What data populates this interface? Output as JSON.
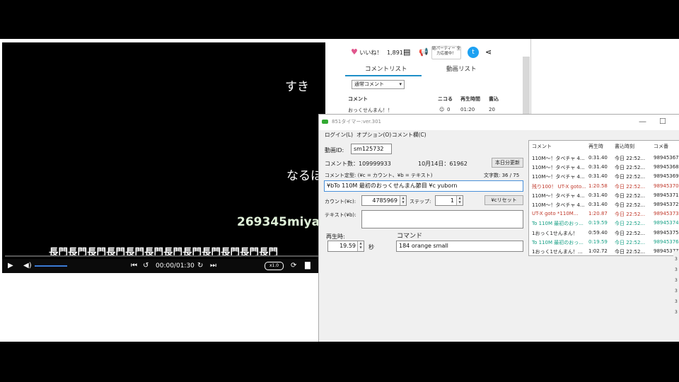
{
  "player": {
    "comments": [
      "すき",
      "な",
      "なるほ",
      "269345miya",
      "長門長門長門長門長門長門長門長門長門長門長門長門"
    ],
    "time": "00:00/01:30",
    "speed": "x1.0"
  },
  "nico": {
    "like_label": "いいね！",
    "like_count": "1,891",
    "party_label": "結パーティー 全力応援中！",
    "tabs": [
      "コメントリスト",
      "動画リスト"
    ],
    "sort_select": "通常コメント",
    "headers": [
      "コメント",
      "ニコる",
      "再生時間",
      "書込"
    ],
    "row": {
      "comment": "おっくせんまん！！",
      "nicoru": "0",
      "time": "01:20",
      "date": "20"
    }
  },
  "timer": {
    "title": "851タイマー:ver.301",
    "menus": [
      "ログイン(L)",
      "オプション(O)",
      "コメント欄(C)"
    ],
    "video_id_label": "動画ID:",
    "video_id": "sm125732",
    "comment_count": "コメント数：109999933",
    "date_info": "10月14日：61962",
    "update_button": "本日分更新",
    "template_label": "コメント定型: (¥c = カウント、¥b = テキスト)",
    "char_count": "文字数: 36 / 75",
    "template_value": "¥bTo 110M 最初のおっくせんまん節目 ¥c yuborn",
    "count_label": "カウント(¥c):",
    "count_value": "4785969",
    "step_label": "ステップ:",
    "step_value": "1",
    "reset_button": "¥cリセット",
    "text_label": "テキスト(¥b):",
    "text_value": "",
    "playtime_label": "再生時:",
    "playtime_value": "19.59",
    "sec_label": "秒",
    "command_label": "コマンド",
    "command_value": "184 orange small"
  },
  "list": {
    "headers": [
      "コメント",
      "再生時",
      "書込時刻",
      "コメ番"
    ],
    "rows": [
      {
        "comment": "110M～！タベチャ 4...",
        "time": "0:31.40",
        "date": "今日 22:52...",
        "no": "98945367",
        "color": "#222222"
      },
      {
        "comment": "110M～！タベチャ 4...",
        "time": "0:31.40",
        "date": "今日 22:52...",
        "no": "98945368",
        "color": "#222222"
      },
      {
        "comment": "110M～！タベチャ 4...",
        "time": "0:31.40",
        "date": "今日 22:52...",
        "no": "98945369",
        "color": "#222222"
      },
      {
        "comment": "残り100！ UT-X goto...",
        "time": "1:20.58",
        "date": "今日 22:52...",
        "no": "98945370",
        "color": "#c0392b"
      },
      {
        "comment": "110M～！タベチャ 4...",
        "time": "0:31.40",
        "date": "今日 22:52...",
        "no": "98945371",
        "color": "#222222"
      },
      {
        "comment": "110M～！タベチャ 4...",
        "time": "0:31.40",
        "date": "今日 22:52...",
        "no": "98945372",
        "color": "#222222"
      },
      {
        "comment": "UT-X goto *110M...",
        "time": "1:20.87",
        "date": "今日 22:52...",
        "no": "98945373",
        "color": "#c0392b"
      },
      {
        "comment": "To 110M 最初のおっ...",
        "time": "0:19.59",
        "date": "今日 22:52...",
        "no": "98945374",
        "color": "#16a085"
      },
      {
        "comment": "1おっく1せんまん！",
        "time": "0:59.40",
        "date": "今日 22:52...",
        "no": "98945375",
        "color": "#222222"
      },
      {
        "comment": "To 110M 最初のおっ...",
        "time": "0:19.59",
        "date": "今日 22:52...",
        "no": "98945376",
        "color": "#16a085"
      },
      {
        "comment": "1おっく1せんまん！...",
        "time": "1:02.72",
        "date": "今日 22:52...",
        "no": "98945377",
        "color": "#222222"
      }
    ]
  }
}
